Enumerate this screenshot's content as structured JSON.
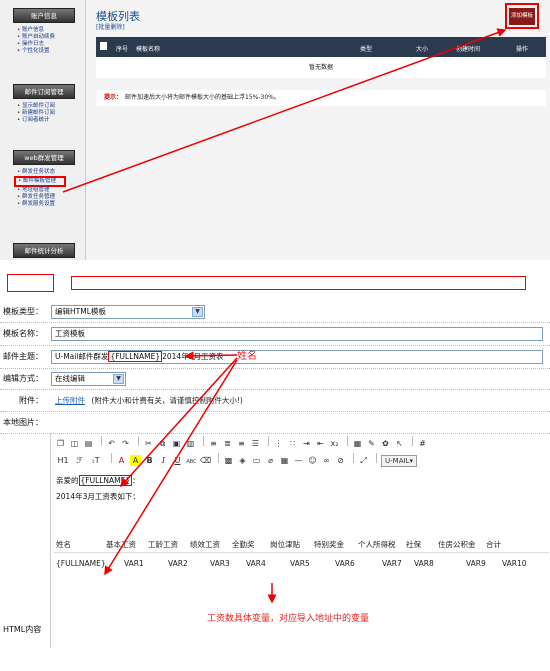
{
  "top_panel": {
    "sidebar": [
      {
        "header": "账户信息",
        "items": [
          "账户信息",
          "账户自动续费",
          "操作日志",
          "个性化设置"
        ]
      },
      {
        "header": "邮件订阅管理",
        "items": [
          "显示邮件订阅",
          "新建邮件订阅",
          "订阅者统计"
        ]
      },
      {
        "header": "web群发管理",
        "items": [
          "群发任务状态",
          "邮件模板管理",
          "地址组管理",
          "群发任务管理",
          "群发服务设置"
        ]
      },
      {
        "header": "邮件统计分析",
        "items": []
      }
    ],
    "highlighted_item": "邮件模板管理",
    "title": "模板列表",
    "batch_delete": "[批量删除]",
    "add_button": "添加模板",
    "table_headers": [
      "序号",
      "模板名称",
      "类型",
      "大小",
      "创建时间",
      "操作"
    ],
    "empty_text": "暂无数据",
    "tip_label": "提示：",
    "tip_text": "邮件加速后大小将为邮件模板大小的基础上浮15%-30%。"
  },
  "form": {
    "template_type_label": "模板类型：",
    "template_type_value": "编辑HTML模板",
    "template_name_label": "模板名称：",
    "template_name_value": "工资模板",
    "subject_label": "邮件主题：",
    "subject_prefix": "U-Mail邮件群发",
    "subject_var": "{FULLNAME}",
    "subject_suffix": "2014年3月工资表",
    "edit_mode_label": "编辑方式：",
    "edit_mode_value": "在线编辑",
    "attachment_label": "附件：",
    "attachment_link": "上传附件",
    "attachment_hint": "(附件大小和计费有关，请谨慎控制附件大小!)",
    "local_image_label": "本地图片：",
    "html_label": "HTML内容",
    "umail_menu": "U-MAIL▾"
  },
  "editor_content": {
    "greeting_prefix": "亲爱的",
    "greeting_var": "{FULLNAME}",
    "greeting_suffix": "：",
    "line2": "2014年3月工资表如下：",
    "table_headers": [
      "姓名",
      "基本工资",
      "工龄工资",
      "绩效工资",
      "全勤奖",
      "岗位津贴",
      "特别奖金",
      "个人所得税",
      "社保",
      "住房公积金",
      "合计"
    ],
    "table_row": [
      "{FULLNAME}",
      "VAR1",
      "VAR2",
      "VAR3",
      "VAR4",
      "VAR5",
      "VAR6",
      "VAR7",
      "VAR8",
      "VAR9",
      "VAR10"
    ]
  },
  "annotations": {
    "name_label": "姓名",
    "vars_label": "工资数具体变量，对应导入地址中的变量"
  }
}
